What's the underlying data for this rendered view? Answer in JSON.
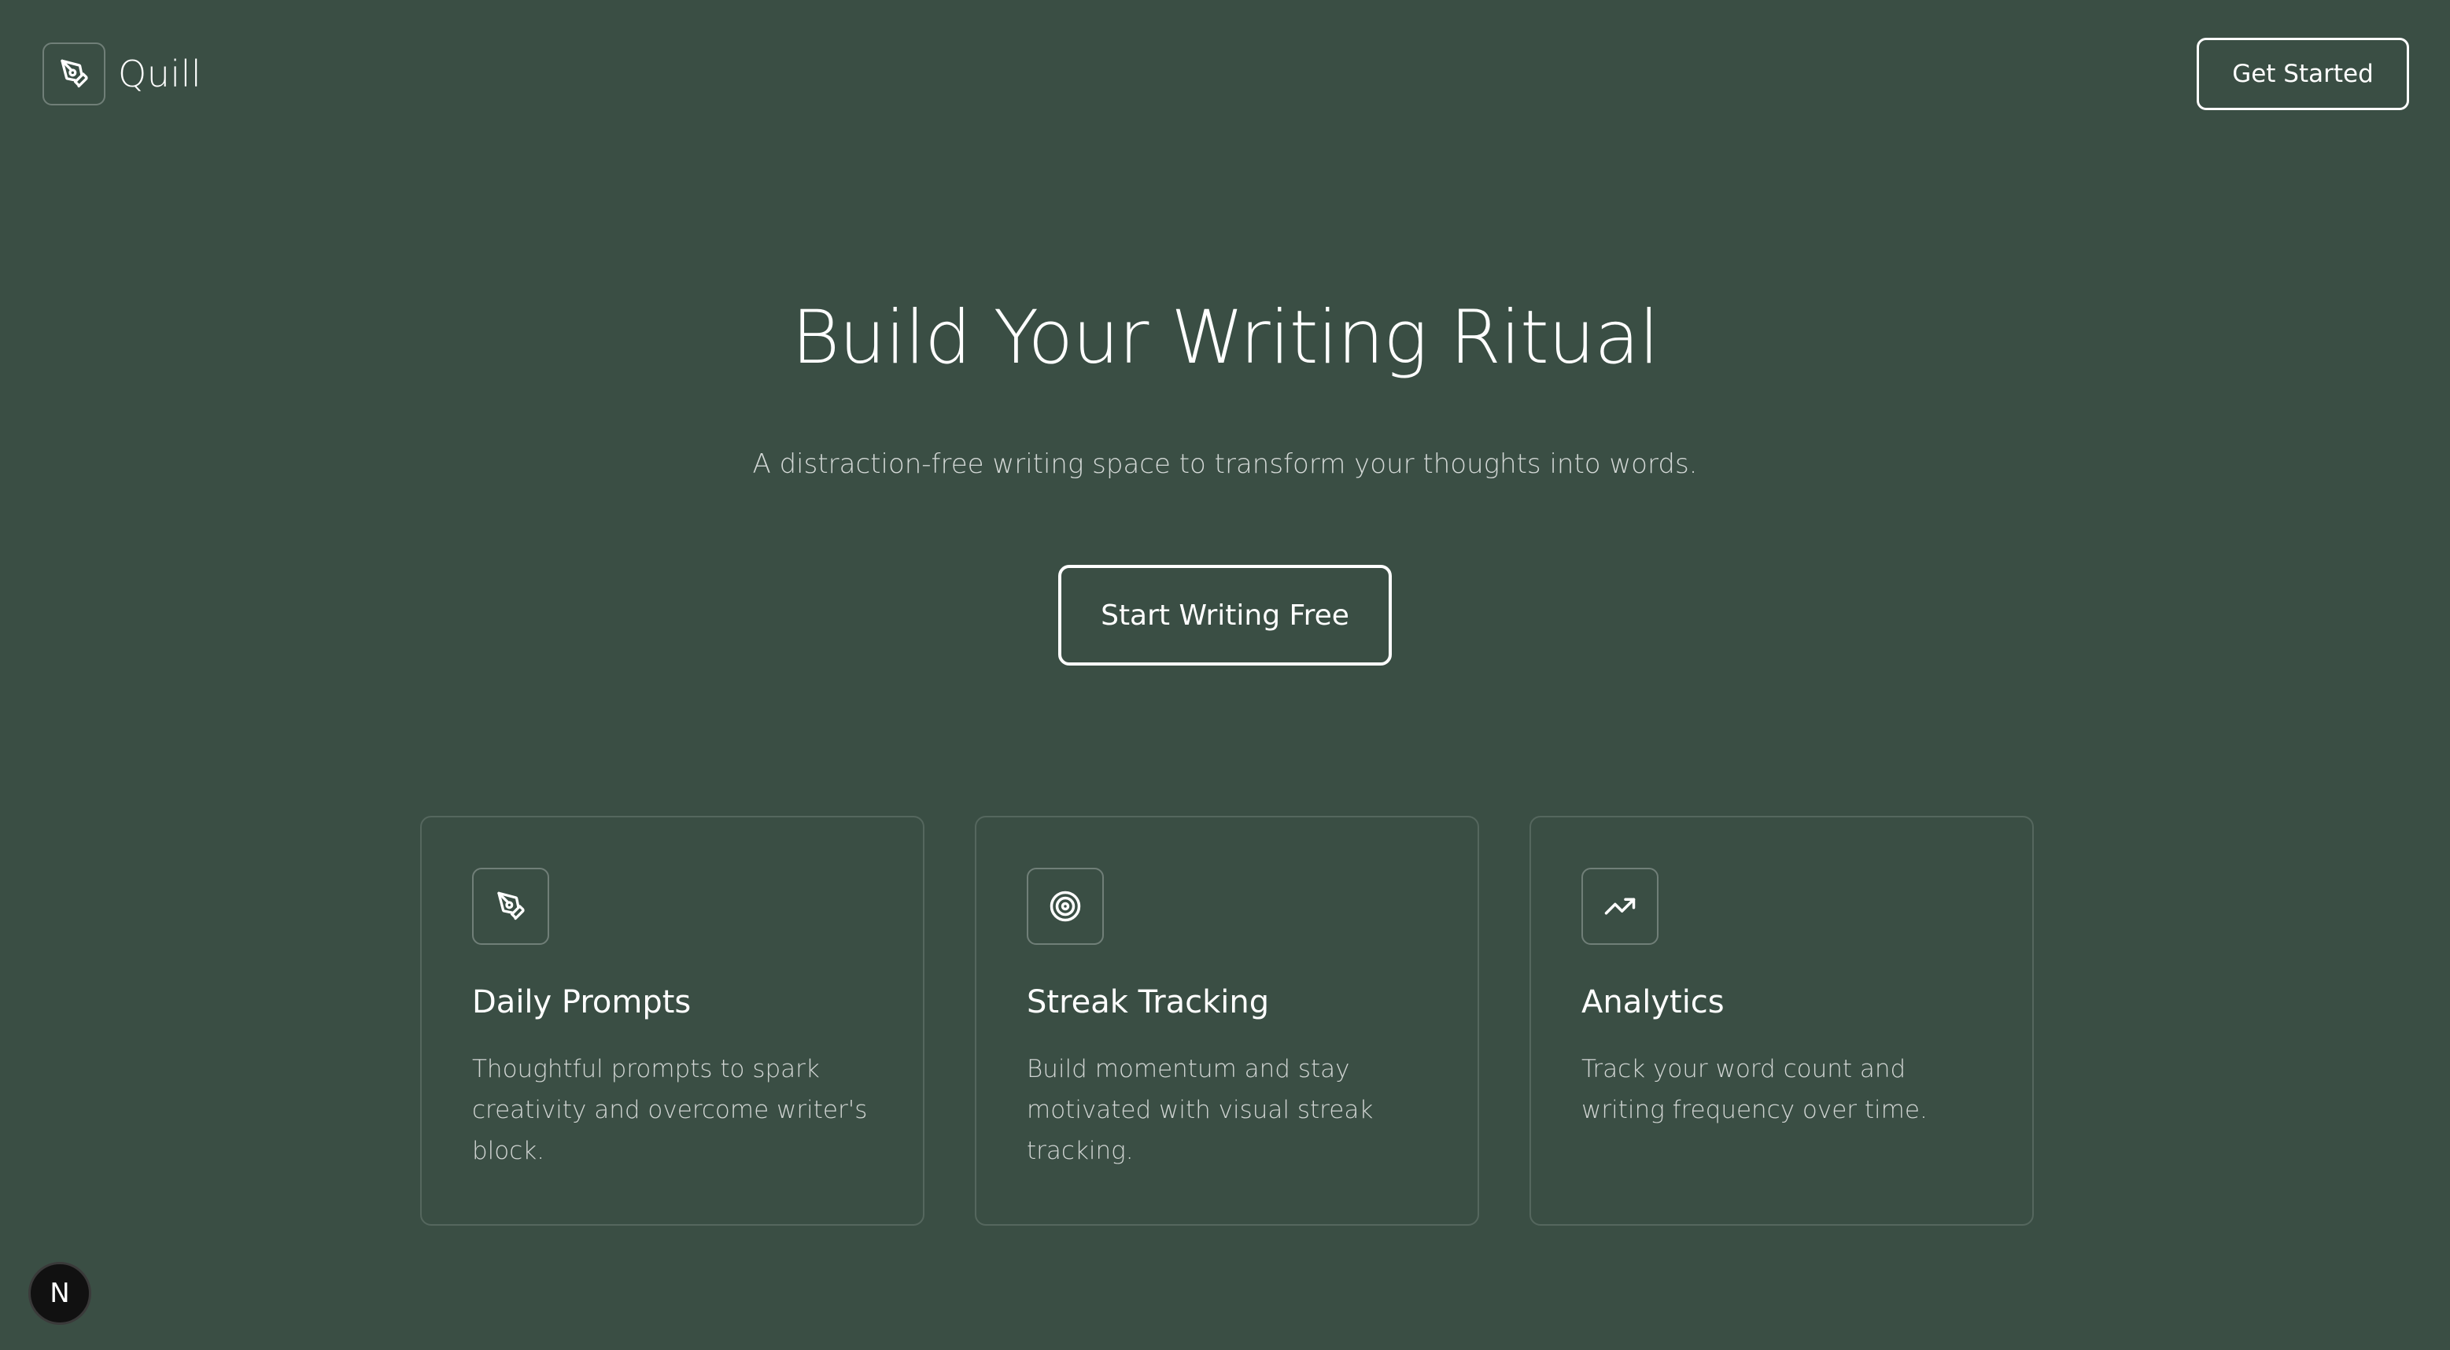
{
  "header": {
    "logo_text": "Quill",
    "get_started_label": "Get Started"
  },
  "hero": {
    "title": "Build Your Writing Ritual",
    "subtitle": "A distraction-free writing space to transform your thoughts into words.",
    "cta_label": "Start Writing Free"
  },
  "features": [
    {
      "icon": "pen-nib-icon",
      "title": "Daily Prompts",
      "description": "Thoughtful prompts to spark creativity and overcome writer's block."
    },
    {
      "icon": "target-icon",
      "title": "Streak Tracking",
      "description": "Build momentum and stay motivated with visual streak tracking."
    },
    {
      "icon": "trending-up-icon",
      "title": "Analytics",
      "description": "Track your word count and writing frequency over time."
    }
  ],
  "badge": {
    "letter": "N"
  },
  "colors": {
    "background": "#3a4e44",
    "text": "#ffffff"
  }
}
